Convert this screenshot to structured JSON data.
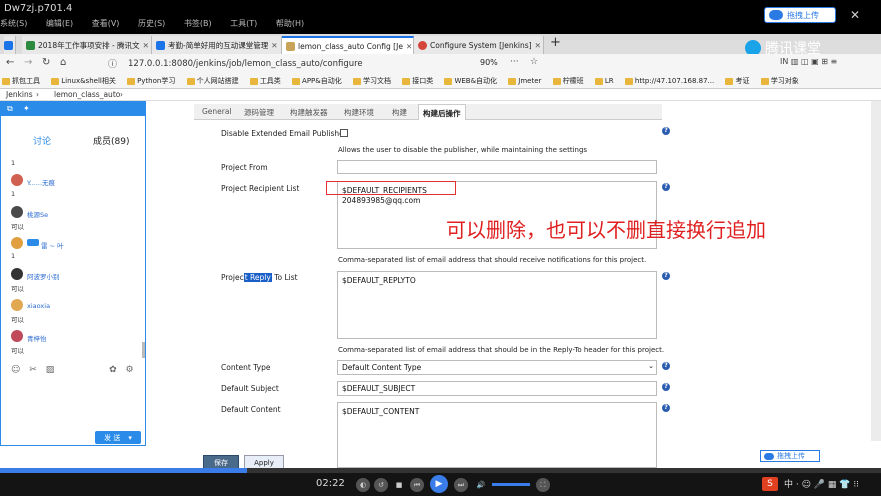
{
  "recording": {
    "title": "Dw7zj.p701.4",
    "menus": [
      "系统(S)",
      "编辑(E)",
      "查看(V)",
      "历史(S)",
      "书签(B)",
      "工具(T)",
      "帮助(H)"
    ],
    "upload_label": "拖拽上传",
    "brand": "腾讯课堂"
  },
  "browser": {
    "tabs": [
      {
        "label": "2018年工作事项安排 - 腾讯文",
        "color": "#2b8a3e"
      },
      {
        "label": "考勤-简单好用的互动课堂管理",
        "color": "#1a73e8"
      },
      {
        "label": "lemon_class_auto Config [Je",
        "color": "#1a73e8",
        "active": true
      },
      {
        "label": "Configure System [Jenkins]",
        "color": "#d4453a"
      }
    ],
    "new_tab": "+",
    "url": "127.0.0.1:8080/jenkins/job/lemon_class_auto/configure",
    "zoom": "90%",
    "bookmarks": [
      "抓包工具",
      "Linux&shell相关",
      "Python学习",
      "个人网站搭建",
      "工具类",
      "APP&自动化",
      "学习文档",
      "接口类",
      "WEB&自动化",
      "Jmeter",
      "柠檬班",
      "LR",
      "http://47.107.168.87...",
      "考证",
      "学习对象"
    ]
  },
  "jenkins": {
    "breadcrumb": [
      "Jenkins",
      "lemon_class_auto"
    ],
    "tabs": [
      "General",
      "源码管理",
      "构建触发器",
      "构建环境",
      "构建",
      "构建后操作"
    ],
    "active_tab": "构建后操作",
    "disable_label": "Disable Extended Email Publisher",
    "disable_desc": "Allows the user to disable the publisher, while maintaining the settings",
    "project_from_label": "Project From",
    "project_from_value": "",
    "recipient_label": "Project Recipient List",
    "recipient_lines": [
      "$DEFAULT_RECIPIENTS",
      "204893985@qq.com"
    ],
    "recipient_desc": "Comma-separated list of email address that should receive notifications for this project.",
    "reply_label_pre": "Projec",
    "reply_label_sel": "t Reply",
    "reply_label_post": " To List",
    "reply_value": "$DEFAULT_REPLYTO",
    "reply_desc": "Comma-separated list of email address that should be in the Reply-To header for this project.",
    "content_type_label": "Content Type",
    "content_type_value": "Default Content Type",
    "subject_label": "Default Subject",
    "subject_value": "$DEFAULT_SUBJECT",
    "content_label": "Default Content",
    "content_value": "$DEFAULT_CONTENT",
    "save_label": "保存",
    "apply_label": "Apply"
  },
  "annotation": "可以删除，也可以不删直接换行追加",
  "chat": {
    "tab_discuss": "讨论",
    "tab_members": "成员(89)",
    "messages": [
      {
        "name": "",
        "text": "1"
      },
      {
        "name": "Y......无痕",
        "text": "1"
      },
      {
        "name": "桃源Se",
        "text": "可以"
      },
      {
        "name": "雷  ~  叶",
        "text": "1"
      },
      {
        "name": "阿波罗小别",
        "text": "可以"
      },
      {
        "name": "xiaoxia",
        "text": "可以"
      },
      {
        "name": "青梓怡",
        "text": "可以"
      }
    ],
    "send_label": "发 送"
  },
  "player": {
    "time": "02:22",
    "upload_label": "拖拽上传",
    "tray": "中 · ☺ 🎤 ▦ 👕 ⁝⁝"
  }
}
